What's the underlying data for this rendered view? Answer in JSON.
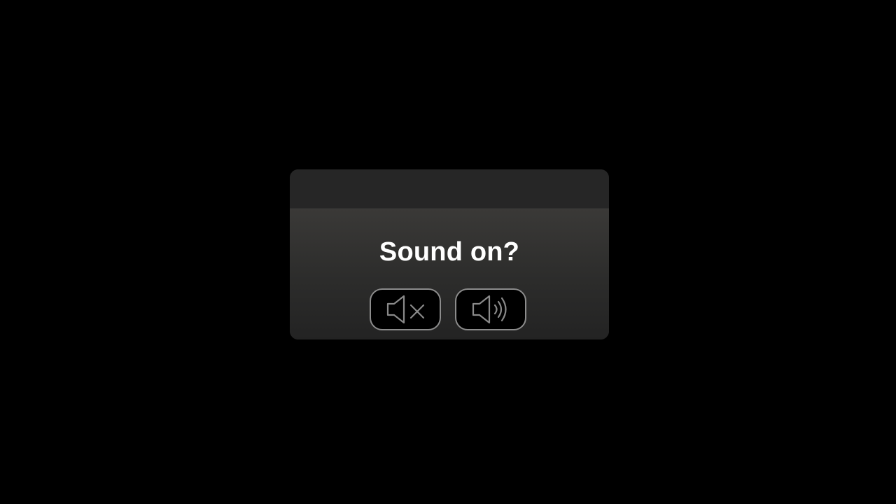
{
  "dialog": {
    "prompt": "Sound on?",
    "buttons": [
      {
        "action": "mute",
        "icon": "speaker-muted-icon"
      },
      {
        "action": "unmute",
        "icon": "speaker-volume-icon"
      }
    ]
  },
  "colors": {
    "background": "#000000",
    "dialog_header": "#262626",
    "dialog_body_top": "#3a3937",
    "dialog_body_bottom": "#232323",
    "prompt_text": "#ffffff",
    "button_border": "#8c8c8c",
    "button_fill": "#000000",
    "icon_stroke": "#8a8a8a"
  }
}
